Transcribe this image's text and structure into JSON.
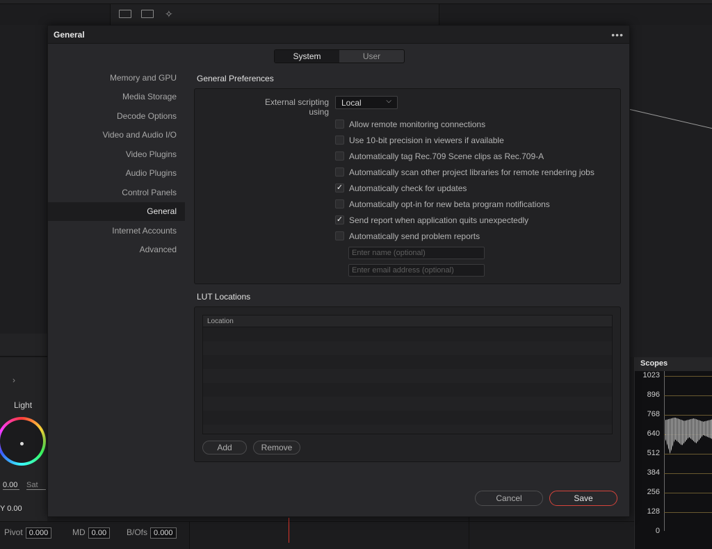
{
  "dialog": {
    "title": "General",
    "more_icon": "more-icon",
    "tabs": [
      {
        "label": "System",
        "active": true
      },
      {
        "label": "User",
        "active": false
      }
    ],
    "sidebar": [
      {
        "label": "Memory and GPU",
        "selected": false
      },
      {
        "label": "Media Storage",
        "selected": false
      },
      {
        "label": "Decode Options",
        "selected": false
      },
      {
        "label": "Video and Audio I/O",
        "selected": false
      },
      {
        "label": "Video Plugins",
        "selected": false
      },
      {
        "label": "Audio Plugins",
        "selected": false
      },
      {
        "label": "Control Panels",
        "selected": false
      },
      {
        "label": "General",
        "selected": true
      },
      {
        "label": "Internet Accounts",
        "selected": false
      },
      {
        "label": "Advanced",
        "selected": false
      }
    ],
    "general_preferences": {
      "title": "General Preferences",
      "external_scripting_label": "External scripting using",
      "external_scripting_value": "Local",
      "checkboxes": [
        {
          "label": "Allow remote monitoring connections",
          "checked": false
        },
        {
          "label": "Use 10-bit precision in viewers if available",
          "checked": false
        },
        {
          "label": "Automatically tag Rec.709 Scene clips as Rec.709-A",
          "checked": false
        },
        {
          "label": "Automatically scan other project libraries for remote rendering jobs",
          "checked": false
        },
        {
          "label": "Automatically check for updates",
          "checked": true
        },
        {
          "label": "Automatically opt-in for new beta program notifications",
          "checked": false
        },
        {
          "label": "Send report when application quits unexpectedly",
          "checked": true
        },
        {
          "label": "Automatically send problem reports",
          "checked": false
        }
      ],
      "name_placeholder": "Enter name (optional)",
      "email_placeholder": "Enter email address (optional)"
    },
    "lut_locations": {
      "title": "LUT Locations",
      "column_header": "Location",
      "add_label": "Add",
      "remove_label": "Remove"
    },
    "cancel_label": "Cancel",
    "save_label": "Save",
    "colors": {
      "accent": "#d6443b",
      "selected_bg": "#1c1c1e"
    }
  },
  "background": {
    "color_panel": {
      "light_label": "Light",
      "value_1": "0.00",
      "sat_label": "Sat",
      "y_value": "0.00",
      "y_label": "Y"
    },
    "bottom_bar": {
      "pivot_label": "Pivot",
      "pivot_value": "0.000",
      "md_label": "MD",
      "md_value": "0.00",
      "bofs_label": "B/Ofs",
      "bofs_value": "0.000"
    },
    "scopes": {
      "title": "Scopes",
      "labels": [
        "1023",
        "896",
        "768",
        "640",
        "512",
        "384",
        "256",
        "128",
        "0"
      ]
    }
  }
}
